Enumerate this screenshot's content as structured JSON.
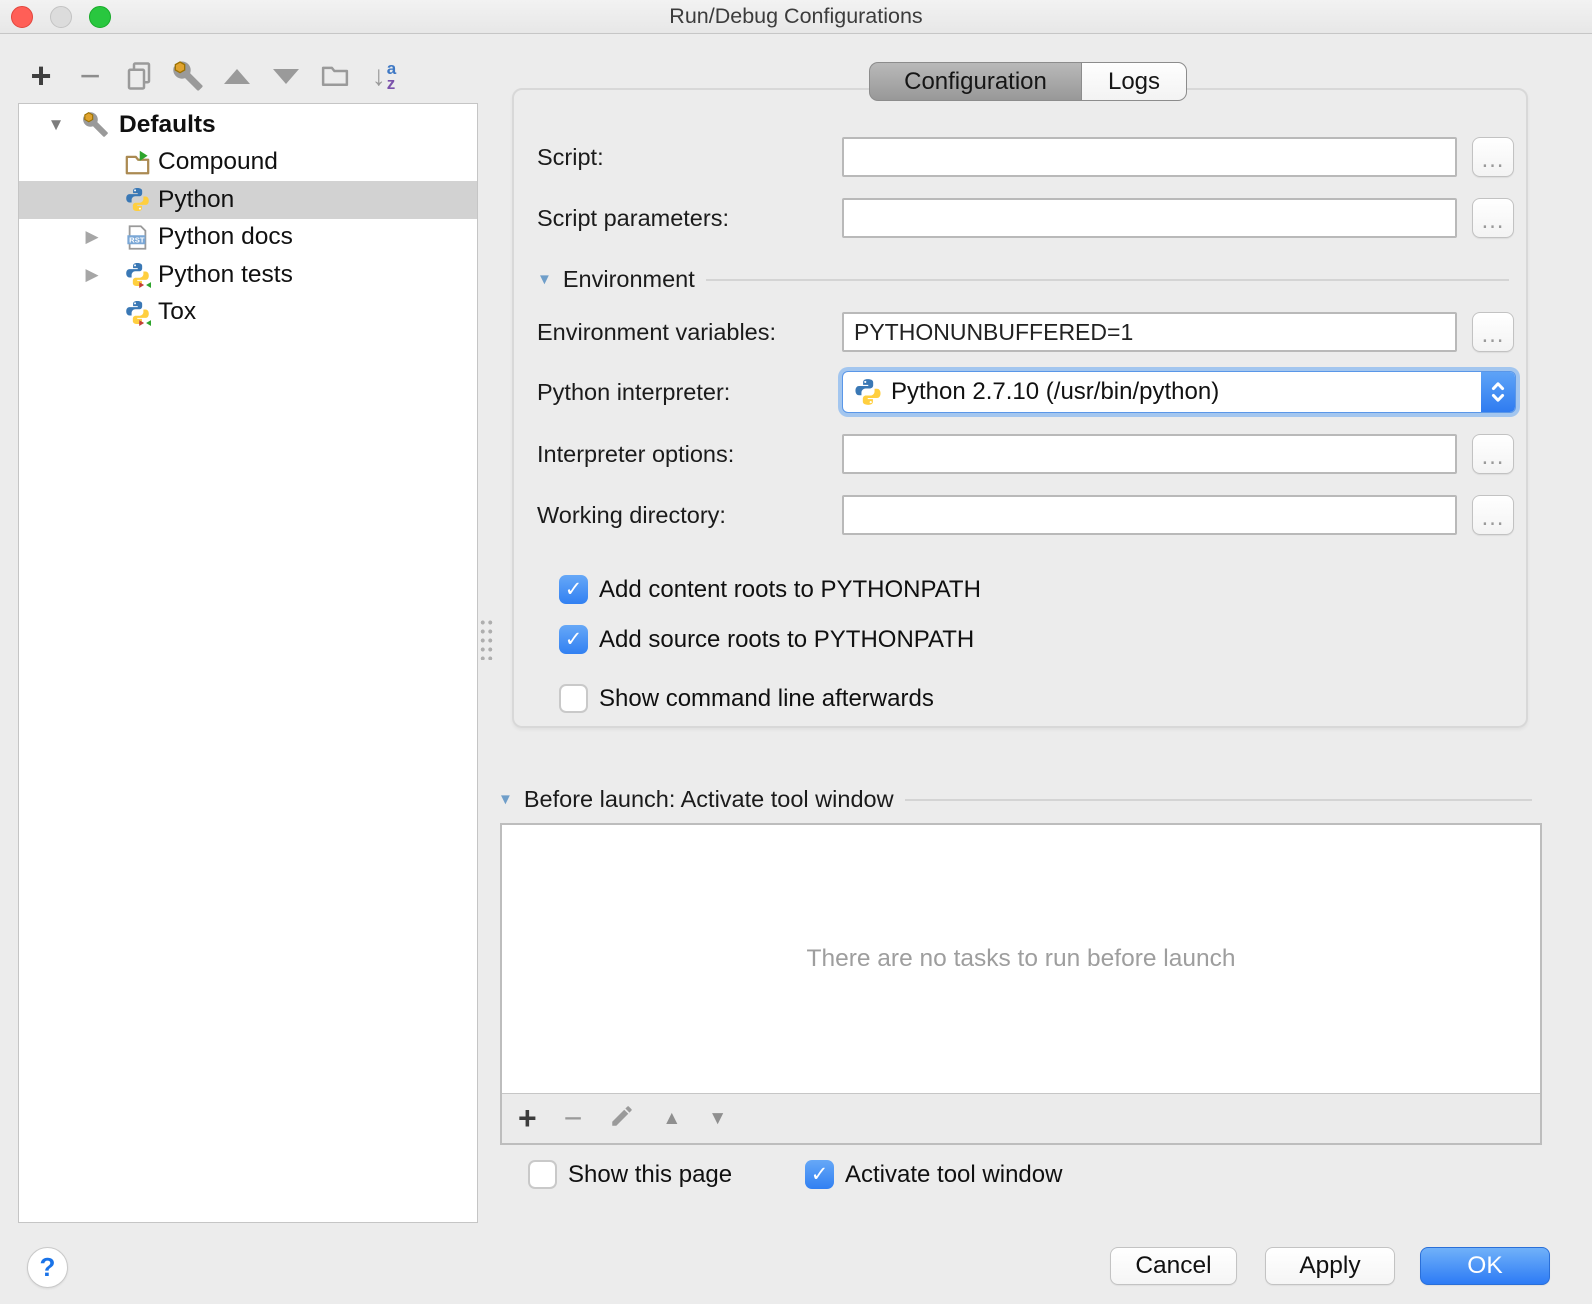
{
  "window": {
    "title": "Run/Debug Configurations"
  },
  "icons": {
    "plus": "+",
    "minus": "−",
    "ellipsis": "…",
    "check": "✓",
    "disclosure_open": "▼",
    "disclosure_closed": "▶",
    "triangle_up": "▲",
    "triangle_down": "▼",
    "arrow_down": "↓",
    "sort_a": "a",
    "sort_z": "z",
    "help": "?"
  },
  "tabs": {
    "configuration": "Configuration",
    "logs": "Logs"
  },
  "tree": {
    "selected": "Python",
    "items": [
      {
        "label": "Defaults"
      },
      {
        "label": "Compound"
      },
      {
        "label": "Python"
      },
      {
        "label": "Python docs",
        "badge": "RST"
      },
      {
        "label": "Python tests"
      },
      {
        "label": "Tox"
      }
    ]
  },
  "form": {
    "script": {
      "label": "Script:",
      "value": ""
    },
    "script_parameters": {
      "label": "Script parameters:",
      "value": ""
    },
    "environment_section": "Environment",
    "environment_variables": {
      "label": "Environment variables:",
      "value": "PYTHONUNBUFFERED=1"
    },
    "python_interpreter": {
      "label": "Python interpreter:",
      "value": "Python 2.7.10 (/usr/bin/python)"
    },
    "interpreter_options": {
      "label": "Interpreter options:",
      "value": ""
    },
    "working_directory": {
      "label": "Working directory:",
      "value": ""
    },
    "add_content_roots": {
      "label": "Add content roots to PYTHONPATH",
      "checked": true
    },
    "add_source_roots": {
      "label": "Add source roots to PYTHONPATH",
      "checked": true
    },
    "show_command_line": {
      "label": "Show command line afterwards",
      "checked": false
    }
  },
  "before_launch": {
    "header": "Before launch: Activate tool window",
    "empty_message": "There are no tasks to run before launch"
  },
  "footer": {
    "show_this_page": {
      "label": "Show this page",
      "checked": false
    },
    "activate_tool_window": {
      "label": "Activate tool window",
      "checked": true
    }
  },
  "buttons": {
    "cancel": "Cancel",
    "apply": "Apply",
    "ok": "OK"
  },
  "colors": {
    "accent_blue": "#3180f2",
    "focus_ring": "#a3c6ef",
    "selection_gray": "#d2d2d2",
    "ok_gradient_top": "#70b1f9",
    "ok_gradient_bottom": "#2d7bf5"
  }
}
